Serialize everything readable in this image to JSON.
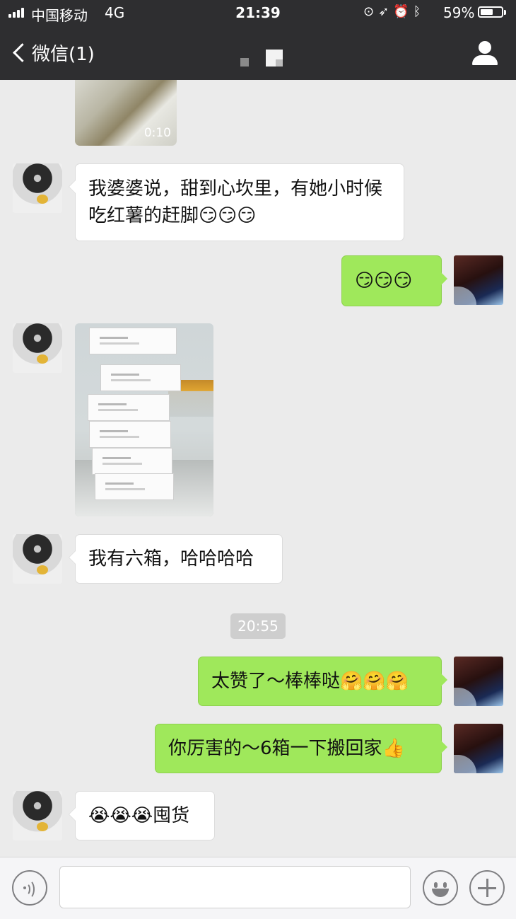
{
  "status_bar": {
    "carrier": "中国移动",
    "network": "4G",
    "time": "21:39",
    "icons": [
      "orientation-lock-icon",
      "location-icon",
      "alarm-icon",
      "bluetooth-icon"
    ],
    "battery_percent": "59%",
    "battery_level": 0.59
  },
  "nav": {
    "back_label": "微信(1)",
    "icons": [
      "back-chevron-icon",
      "profile-icon"
    ]
  },
  "video_message": {
    "duration": "0:10"
  },
  "messages": {
    "m1": "我婆婆说，甜到心坎里，有她小时候吃红薯的赶脚😏😏😏",
    "m2": "😏😏😏",
    "m3": "我有六箱，哈哈哈哈",
    "timestamp": "20:55",
    "m4": "太赞了～棒棒哒🤗🤗🤗",
    "m5": "你厉害的～6箱一下搬回家👍",
    "m6": "😭😭😭囤货"
  },
  "photo_message": {
    "description_icon": "image-boxes-photo"
  },
  "input_bar": {
    "icons": [
      "voice-icon",
      "emoji-icon",
      "plus-icon"
    ],
    "text_value": ""
  },
  "colors": {
    "nav_bg": "#2e2e30",
    "chat_bg": "#ebebeb",
    "outgoing_bubble": "#9fe85b",
    "incoming_bubble": "#ffffff",
    "timestamp_bg": "#cecece"
  }
}
